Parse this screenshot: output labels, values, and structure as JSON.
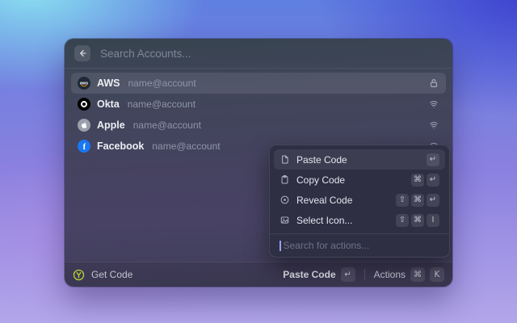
{
  "window": {
    "search_placeholder": "Search Accounts...",
    "accounts": [
      {
        "name": "AWS",
        "subtitle": "name@account",
        "icon": "aws-logo",
        "right_icon": "lock-icon",
        "selected": true
      },
      {
        "name": "Okta",
        "subtitle": "name@account",
        "icon": "okta-logo",
        "right_icon": "fingerprint-icon",
        "selected": false
      },
      {
        "name": "Apple",
        "subtitle": "name@account",
        "icon": "apple-logo",
        "right_icon": "fingerprint-icon",
        "selected": false
      },
      {
        "name": "Facebook",
        "subtitle": "name@account",
        "icon": "facebook-logo",
        "right_icon": "fingerprint-icon",
        "selected": false
      }
    ],
    "footer": {
      "app_label": "Get Code",
      "app_icon": "y-logo-icon",
      "primary_action": "Paste Code",
      "primary_key": "↵",
      "actions_label": "Actions",
      "actions_keys": [
        "⌘",
        "K"
      ]
    }
  },
  "menu": {
    "items": [
      {
        "label": "Paste Code",
        "icon": "document-icon",
        "keys": [
          "↵"
        ],
        "selected": true
      },
      {
        "label": "Copy Code",
        "icon": "clipboard-icon",
        "keys": [
          "⌘",
          "↵"
        ],
        "selected": false
      },
      {
        "label": "Reveal Code",
        "icon": "eye-icon",
        "keys": [
          "⇧",
          "⌘",
          "↵"
        ],
        "selected": false
      },
      {
        "label": "Select Icon...",
        "icon": "image-icon",
        "keys": [
          "⇧",
          "⌘",
          "I"
        ],
        "selected": false
      }
    ],
    "search_placeholder": "Search for actions..."
  },
  "colors": {
    "logo_green": "#b9d338",
    "facebook_blue": "#1877f2",
    "okta_black": "#000000",
    "apple_gray": "#9aa0ab",
    "aws_dark": "#1f2a37",
    "aws_smile_orange": "#ff9900",
    "menu_background": "#2d2e42",
    "background_top_left": "#8ee9f3",
    "background_top_right": "#3c3ecf",
    "background_bottom": "#b3a6ea"
  }
}
